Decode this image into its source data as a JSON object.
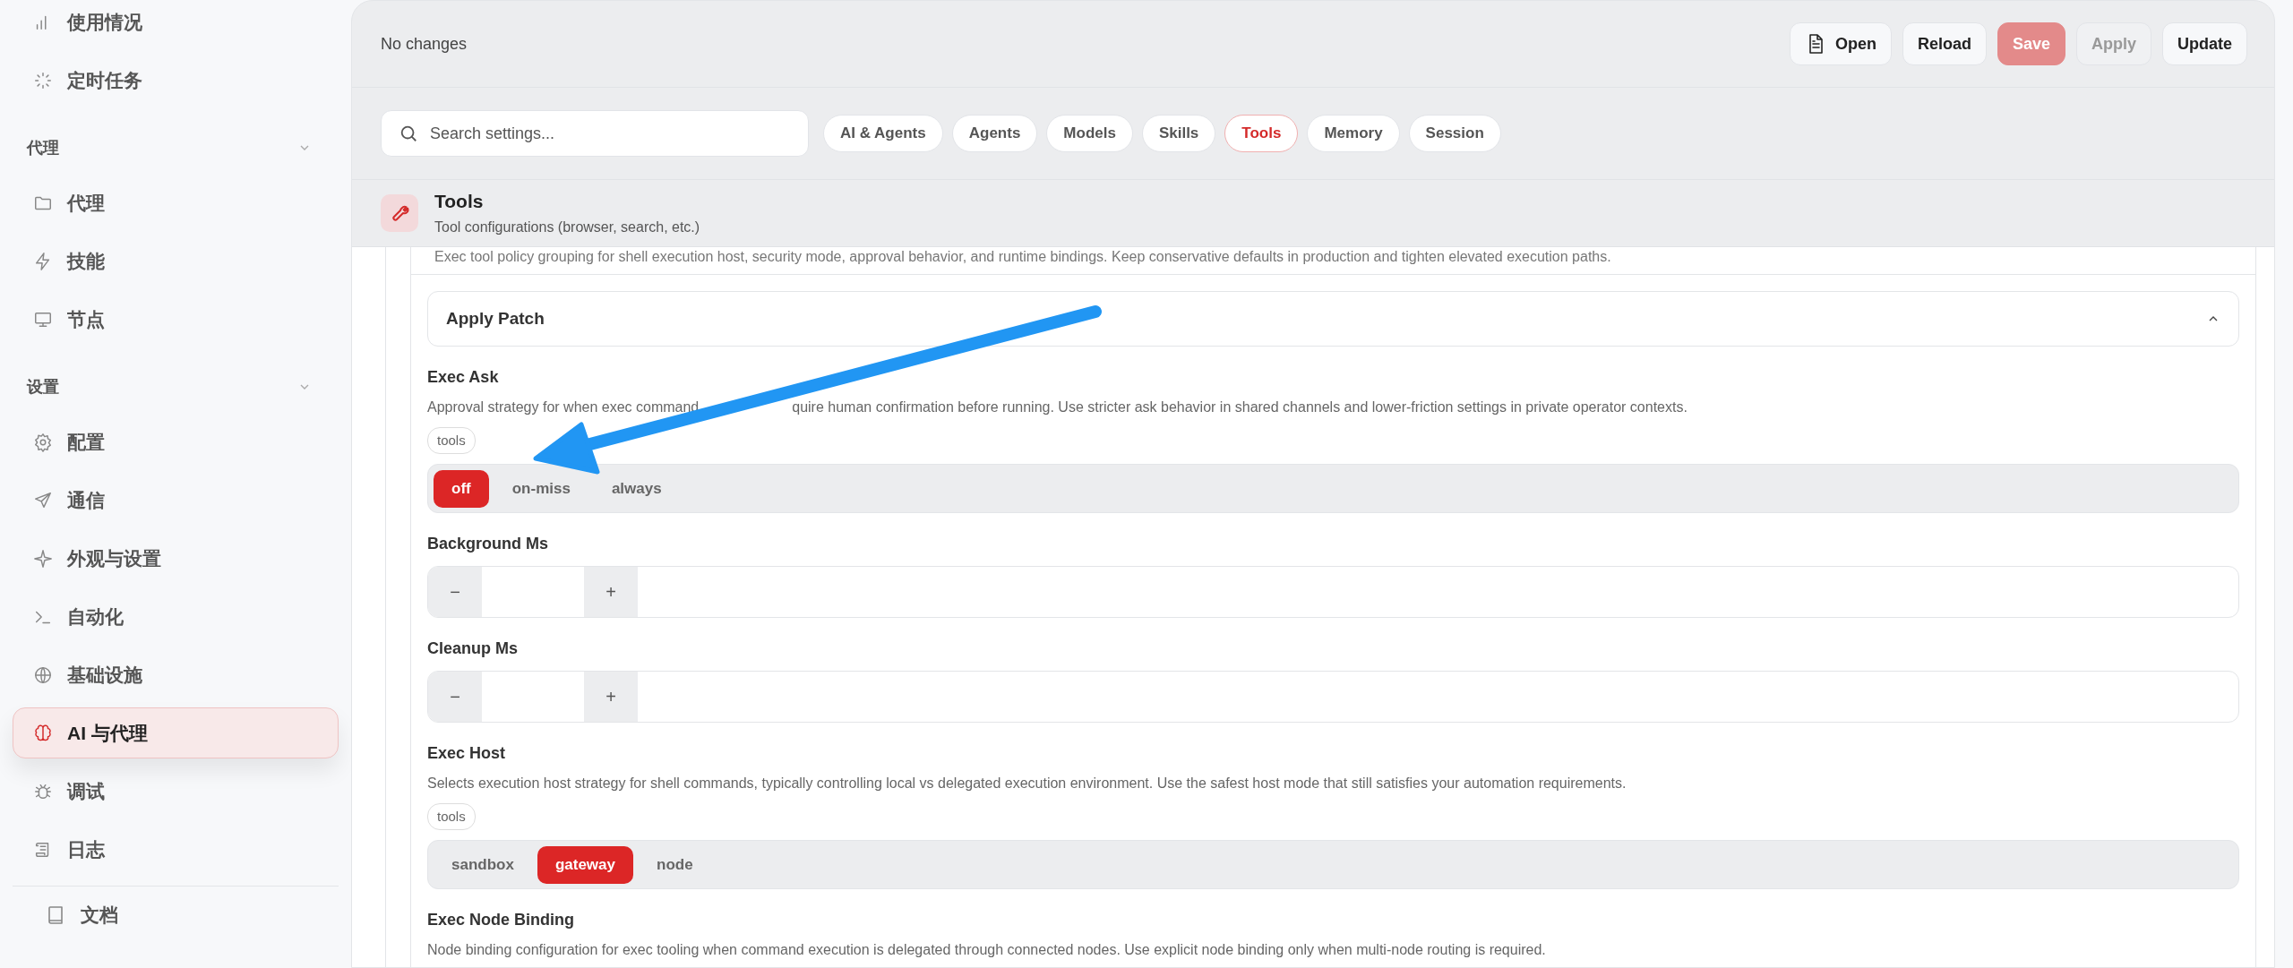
{
  "sidebar": {
    "items": [
      {
        "kind": "item",
        "label": "使用情况",
        "selected": false
      },
      {
        "kind": "item",
        "label": "定时任务",
        "selected": false
      },
      {
        "kind": "section",
        "label": "代理",
        "expanded": true
      },
      {
        "kind": "item",
        "label": "代理",
        "selected": false
      },
      {
        "kind": "item",
        "label": "技能",
        "selected": false
      },
      {
        "kind": "item",
        "label": "节点",
        "selected": false
      },
      {
        "kind": "section",
        "label": "设置",
        "expanded": true
      },
      {
        "kind": "item",
        "label": "配置",
        "selected": false
      },
      {
        "kind": "item",
        "label": "通信",
        "selected": false
      },
      {
        "kind": "item",
        "label": "外观与设置",
        "selected": false
      },
      {
        "kind": "item",
        "label": "自动化",
        "selected": false
      },
      {
        "kind": "item",
        "label": "基础设施",
        "selected": false
      },
      {
        "kind": "item",
        "label": "AI 与代理",
        "selected": true
      },
      {
        "kind": "item",
        "label": "调试",
        "selected": false
      },
      {
        "kind": "item",
        "label": "日志",
        "selected": false
      }
    ],
    "footer": {
      "label": "文档"
    }
  },
  "toolbar": {
    "status": "No changes",
    "buttons": [
      {
        "label": "Open",
        "disabled": false
      },
      {
        "label": "Reload",
        "disabled": false
      },
      {
        "label": "Save",
        "disabled": true
      },
      {
        "label": "Apply",
        "disabled": true
      },
      {
        "label": "Update",
        "disabled": false
      }
    ]
  },
  "search": {
    "placeholder": "Search settings..."
  },
  "tabs": [
    {
      "label": "AI & Agents",
      "selected": false
    },
    {
      "label": "Agents",
      "selected": false
    },
    {
      "label": "Models",
      "selected": false
    },
    {
      "label": "Skills",
      "selected": false
    },
    {
      "label": "Tools",
      "selected": true
    },
    {
      "label": "Memory",
      "selected": false
    },
    {
      "label": "Session",
      "selected": false
    }
  ],
  "section": {
    "title": "Tools",
    "subtitle": "Tool configurations (browser, search, etc.)"
  },
  "group_description": "Exec tool policy grouping for shell execution host, security mode, approval behavior, and runtime bindings. Keep conservative defaults in production and tighten elevated execution paths.",
  "subsection": {
    "title": "Apply Patch",
    "expanded": true
  },
  "fields": [
    {
      "kind": "segmented",
      "label": "Exec Ask",
      "description": [
        "Approval strategy for when exec command",
        "quire human confirmation before running. Use stricter ask behavior in shared channels and lower-friction settings in private operator contexts."
      ],
      "tag": "tools",
      "options": [
        {
          "label": "off",
          "selected": true
        },
        {
          "label": "on-miss",
          "selected": false
        },
        {
          "label": "always",
          "selected": false
        }
      ]
    },
    {
      "kind": "number",
      "label": "Background Ms",
      "minus": "−",
      "plus": "+"
    },
    {
      "kind": "number",
      "label": "Cleanup Ms",
      "minus": "−",
      "plus": "+"
    },
    {
      "kind": "segmented",
      "label": "Exec Host",
      "description": [
        "Selects execution host strategy for shell commands, typically controlling local vs delegated execution environment. Use the safest host mode that still satisfies your automation requirements."
      ],
      "tag": "tools",
      "options": [
        {
          "label": "sandbox",
          "selected": false
        },
        {
          "label": "gateway",
          "selected": true
        },
        {
          "label": "node",
          "selected": false
        }
      ]
    },
    {
      "kind": "text",
      "label": "Exec Node Binding",
      "description": [
        "Node binding configuration for exec tooling when command execution is delegated through connected nodes. Use explicit node binding only when multi-node routing is required."
      ]
    }
  ],
  "annotation": {
    "kind": "arrow"
  }
}
